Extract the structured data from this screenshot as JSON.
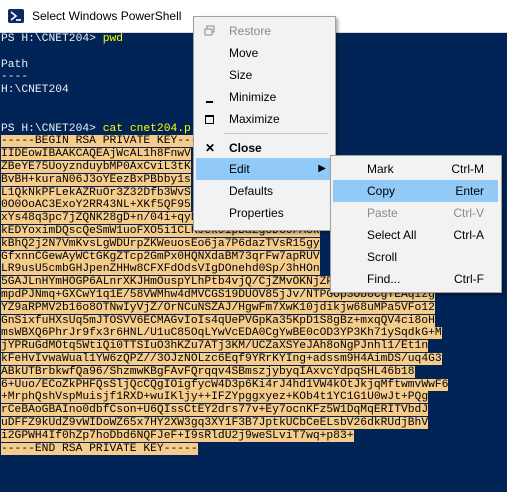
{
  "window": {
    "title": "Select Windows PowerShell",
    "icon": "powershell-icon"
  },
  "console": {
    "lines": [
      {
        "text": "PS H:\\CNET204> ",
        "cmd": "pwd",
        "selected": false
      },
      {
        "text": "",
        "selected": false
      },
      {
        "text": "Path",
        "selected": false
      },
      {
        "text": "----",
        "selected": false
      },
      {
        "text": "H:\\CNET204",
        "selected": false
      },
      {
        "text": "",
        "selected": false
      },
      {
        "text": "",
        "selected": false
      },
      {
        "text": "PS H:\\CNET204> ",
        "cmd": "cat cnet204.p",
        "selected": false
      },
      {
        "text": "-----BEGIN RSA PRIVATE KEY-----",
        "selected": true
      },
      {
        "text": "IIDEowIBAAKCAQEAjWcAL1h8FnwV",
        "selected": true
      },
      {
        "text": "ZBeYE75UoyznduybMP0AxCviL3tK",
        "selected": true
      },
      {
        "text": "BvBH+kuraN06J3oYEezBxPBbby1s",
        "selected": true
      },
      {
        "text": "L1QkNkPFLekAZRuOr3Z32Dfb3WvS",
        "selected": true
      },
      {
        "text": "0O0OoAC3ExoY2RR43NL+XKf5QF95",
        "selected": true
      },
      {
        "text": "xYs48q3pc7jZQNK28gD+n/04i+qyD469Tr7iswIDAQABAoI",
        "selected": true
      },
      {
        "text": "kEDYoximDQscQeSmW1uoFXO5i1CLR9ek9ipBa2g8DG0/Ack",
        "selected": true
      },
      {
        "text": "kBhQ2j2N7VmKvsLgWDUrpZKWeuosEo6ja7P6dazTVsR15gy",
        "selected": true
      },
      {
        "text": "GfxnnCGewAyWCtGKgZTcp2GmPx0HQNXdaBM73qrFw7apRUV",
        "selected": true
      },
      {
        "text": "LR9usU5cmbGHJpenZHHw8CFXFdOdsVIgDOnehd0Sp/3hHOn",
        "selected": true
      },
      {
        "text": "5GAJLnHYmHOGP6ALnrXKJHmOuspYLhPtb4vjQ/CjZMvOKNjZPCwsd8UT4G3KePi",
        "selected": true
      },
      {
        "text": "mpdPJNmq+GXCwY1q1E/58VWMhw4dMVCGS19DUOV85jJv/NTPGOp3Ob8CgYEAqizg",
        "selected": true
      },
      {
        "text": "YZ9aRPMV2b16o8OTNwIyVjZ/OrNCuNSZAJ/HgwFm7XwK10jdikjw68uMPa5VFo12",
        "selected": true
      },
      {
        "text": "GnSixfuHXsUq5mJTOSVV6ECMAGvIoIs4qUePVGpKa35KpD1S8gBz+mxqQV4ci8oH",
        "selected": true
      },
      {
        "text": "msWBXQ6PhrJr9fx3r6HNL/U1uC85OqLYwVcEDA0CgYwBE0cOD3YP3Kh71ySqdkG+M",
        "selected": true
      },
      {
        "text": "jYPRuGdMOtq5WtiQi0TTSIuO3hKZu7ATj3KM/UCZaXSYeJAh8oNgPJnhl1/Et1n",
        "selected": true
      },
      {
        "text": "kFeHvIvwaWual1YW6zQPZ//3OJzNOLzc6Eqf9YRrKYIng+adssm9H4AimDS/uq4G3",
        "selected": true
      },
      {
        "text": "ABkUTBrbkwfQa96/ShzmwKBgFAvFQrqqv4SBmszjybyqIAxvcYdpqSHL46b18",
        "selected": true
      },
      {
        "text": "6+Uuo/ECoZkPHFQsSljQcCQgIOigfycW4D3p6Ki4rJ4hd1VW4kOtJkjqMftwmvWwF6",
        "selected": true
      },
      {
        "text": "+MrphQshVspMuisjf1RXD+wuIKljy++IFZYpggxyez+KOb4t1YC1G1U0wJt+PQg",
        "selected": true
      },
      {
        "text": "rCeBAoGBAIno0dbfCson+U6QIssCtEY2drs77v+Ey7ocnKFz5W1DqMqERITVbdJ",
        "selected": true
      },
      {
        "text": "uDFFZ9kUdZ9vWIDoWZ65x7HY2XW3gq3XY1F3B7JptkUCbCeELsbV26dkRUdjBhV",
        "selected": true
      },
      {
        "text": "i2GPWH4If0hZp7hoDbd6NQFJeF+I9sRldU2j9weSLviT7wq+p83+",
        "selected": true
      },
      {
        "text": "-----END RSA PRIVATE KEY-----",
        "selected": true
      }
    ]
  },
  "system_menu": {
    "items": [
      {
        "label": "Restore",
        "glyph": "restore-icon",
        "disabled": true
      },
      {
        "label": "Move",
        "disabled": false
      },
      {
        "label": "Size",
        "disabled": false
      },
      {
        "label": "Minimize",
        "glyph": "minimize-icon",
        "disabled": false
      },
      {
        "label": "Maximize",
        "glyph": "maximize-icon",
        "disabled": false
      },
      {
        "label": "Close",
        "glyph": "close-icon",
        "disabled": false,
        "bold": true
      },
      {
        "label": "Edit",
        "submenu": true,
        "highlighted": true
      },
      {
        "label": "Defaults",
        "disabled": false
      },
      {
        "label": "Properties",
        "disabled": false
      }
    ]
  },
  "edit_menu": {
    "items": [
      {
        "label": "Mark",
        "shortcut": "Ctrl-M",
        "disabled": false
      },
      {
        "label": "Copy",
        "shortcut": "Enter",
        "disabled": false,
        "highlighted": true
      },
      {
        "label": "Paste",
        "shortcut": "Ctrl-V",
        "disabled": true
      },
      {
        "label": "Select All",
        "shortcut": "Ctrl-A",
        "disabled": false
      },
      {
        "label": "Scroll",
        "shortcut": "",
        "disabled": false
      },
      {
        "label": "Find...",
        "shortcut": "Ctrl-F",
        "disabled": false
      }
    ]
  },
  "colors": {
    "console_bg": "#012456",
    "console_fg": "#eeedf0",
    "command": "#ffff00",
    "selection": "#f5cc8c",
    "menu_bg": "#f2f2f2",
    "menu_highlight": "#91c9f7"
  }
}
